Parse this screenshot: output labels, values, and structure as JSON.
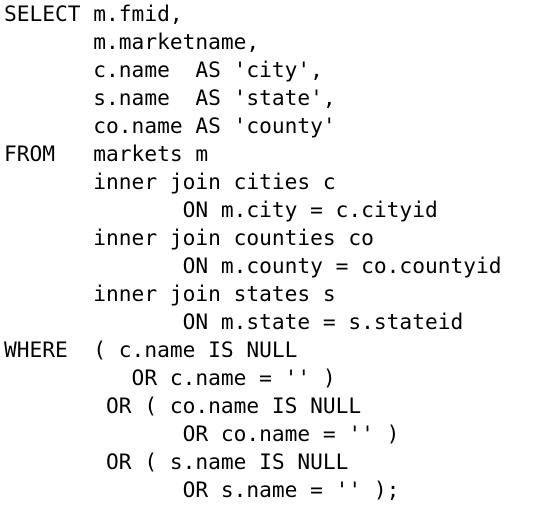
{
  "code": {
    "language": "SQL",
    "lines": [
      "SELECT m.fmid,",
      "       m.marketname,",
      "       c.name  AS 'city',",
      "       s.name  AS 'state',",
      "       co.name AS 'county'",
      "FROM   markets m",
      "       inner join cities c",
      "              ON m.city = c.cityid",
      "       inner join counties co",
      "              ON m.county = co.countyid",
      "       inner join states s",
      "              ON m.state = s.stateid",
      "WHERE  ( c.name IS NULL",
      "          OR c.name = '' )",
      "        OR ( co.name IS NULL",
      "              OR co.name = '' )",
      "        OR ( s.name IS NULL",
      "              OR s.name = '' );"
    ]
  }
}
